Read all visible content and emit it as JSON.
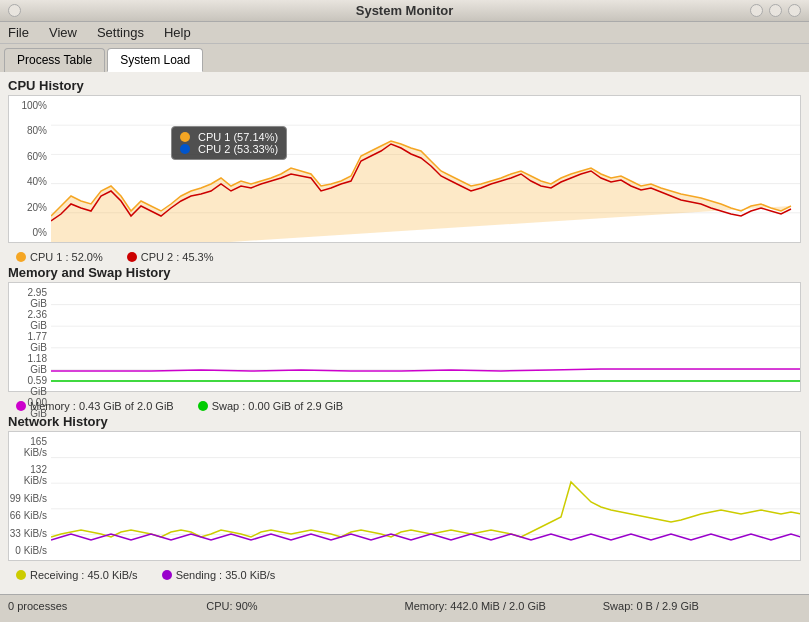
{
  "window": {
    "title": "System Monitor"
  },
  "menubar": {
    "items": [
      "File",
      "View",
      "Settings",
      "Help"
    ]
  },
  "tabs": [
    {
      "label": "Process Table",
      "active": false
    },
    {
      "label": "System Load",
      "active": true
    }
  ],
  "cpu_section": {
    "title": "CPU History",
    "y_labels": [
      "100%",
      "80%",
      "60%",
      "40%",
      "20%",
      "0%"
    ],
    "tooltip": {
      "cpu1_label": "CPU 1 (57.14%)",
      "cpu2_label": "CPU 2 (53.33%)"
    },
    "legend": [
      {
        "label": "CPU 1 : 52.0%",
        "color": "#f5a623"
      },
      {
        "label": "CPU 2 : 45.3%",
        "color": "#cc0000"
      }
    ]
  },
  "memory_section": {
    "title": "Memory and Swap History",
    "y_labels": [
      "2.95 GiB",
      "2.36 GiB",
      "1.77 GiB",
      "1.18 GiB",
      "0.59 GiB",
      "0.00 GiB"
    ],
    "legend": [
      {
        "label": "Memory : 0.43 GiB of 2.0 GiB",
        "color": "#cc00cc"
      },
      {
        "label": "Swap : 0.00 GiB of 2.9 GiB",
        "color": "#00cc00"
      }
    ]
  },
  "network_section": {
    "title": "Network History",
    "y_labels": [
      "165 KiB/s",
      "132 KiB/s",
      "99 KiB/s",
      "66 KiB/s",
      "33 KiB/s",
      "0 KiB/s"
    ],
    "legend": [
      {
        "label": "Receiving : 45.0 KiB/s",
        "color": "#cccc00"
      },
      {
        "label": "Sending : 35.0 KiB/s",
        "color": "#9900cc"
      }
    ]
  },
  "statusbar": {
    "processes": "0 processes",
    "cpu": "CPU: 90%",
    "memory": "Memory: 442.0 MiB / 2.0 GiB",
    "swap": "Swap: 0 B / 2.9 GiB"
  }
}
